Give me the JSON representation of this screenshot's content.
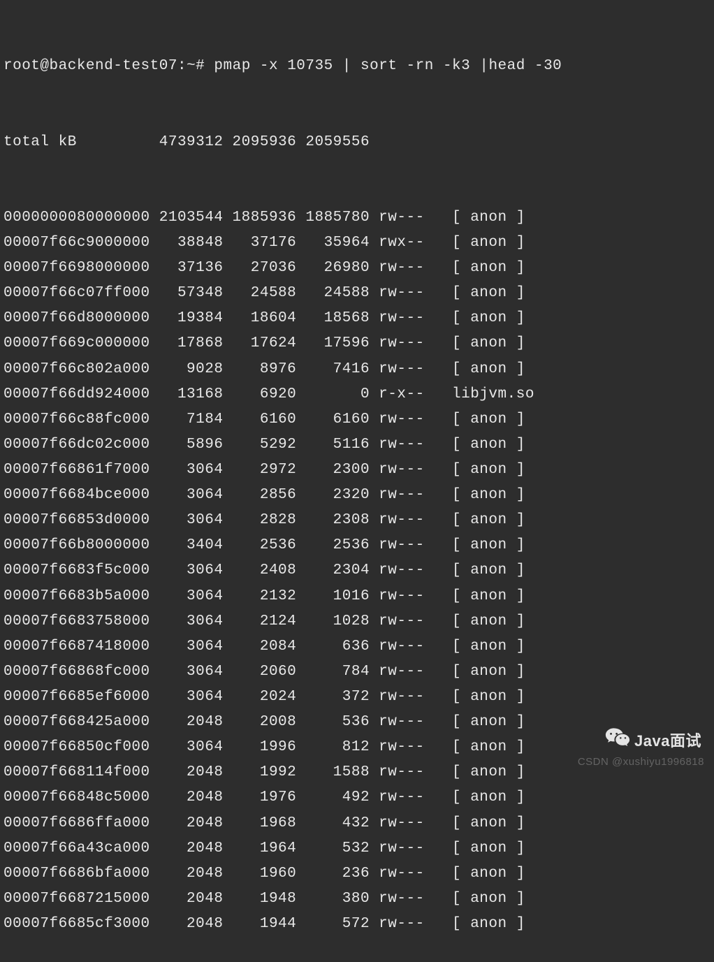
{
  "prompt": {
    "user_host": "root@backend-test07",
    "cwd": "~",
    "symbol": "#",
    "command": "pmap -x 10735 | sort -rn -k3 |head -30"
  },
  "total_row": {
    "label": "total kB",
    "kbytes": "4739312",
    "rss": "2095936",
    "dirty": "2059556"
  },
  "rows": [
    {
      "addr": "0000000080000000",
      "kb": "2103544",
      "rss": "1885936",
      "dirty": "1885780",
      "mode": "rw---",
      "mapping": "[ anon ]"
    },
    {
      "addr": "00007f66c9000000",
      "kb": "38848",
      "rss": "37176",
      "dirty": "35964",
      "mode": "rwx--",
      "mapping": "[ anon ]"
    },
    {
      "addr": "00007f6698000000",
      "kb": "37136",
      "rss": "27036",
      "dirty": "26980",
      "mode": "rw---",
      "mapping": "[ anon ]"
    },
    {
      "addr": "00007f66c07ff000",
      "kb": "57348",
      "rss": "24588",
      "dirty": "24588",
      "mode": "rw---",
      "mapping": "[ anon ]"
    },
    {
      "addr": "00007f66d8000000",
      "kb": "19384",
      "rss": "18604",
      "dirty": "18568",
      "mode": "rw---",
      "mapping": "[ anon ]"
    },
    {
      "addr": "00007f669c000000",
      "kb": "17868",
      "rss": "17624",
      "dirty": "17596",
      "mode": "rw---",
      "mapping": "[ anon ]"
    },
    {
      "addr": "00007f66c802a000",
      "kb": "9028",
      "rss": "8976",
      "dirty": "7416",
      "mode": "rw---",
      "mapping": "[ anon ]"
    },
    {
      "addr": "00007f66dd924000",
      "kb": "13168",
      "rss": "6920",
      "dirty": "0",
      "mode": "r-x--",
      "mapping": "libjvm.so"
    },
    {
      "addr": "00007f66c88fc000",
      "kb": "7184",
      "rss": "6160",
      "dirty": "6160",
      "mode": "rw---",
      "mapping": "[ anon ]"
    },
    {
      "addr": "00007f66dc02c000",
      "kb": "5896",
      "rss": "5292",
      "dirty": "5116",
      "mode": "rw---",
      "mapping": "[ anon ]"
    },
    {
      "addr": "00007f66861f7000",
      "kb": "3064",
      "rss": "2972",
      "dirty": "2300",
      "mode": "rw---",
      "mapping": "[ anon ]"
    },
    {
      "addr": "00007f6684bce000",
      "kb": "3064",
      "rss": "2856",
      "dirty": "2320",
      "mode": "rw---",
      "mapping": "[ anon ]"
    },
    {
      "addr": "00007f66853d0000",
      "kb": "3064",
      "rss": "2828",
      "dirty": "2308",
      "mode": "rw---",
      "mapping": "[ anon ]"
    },
    {
      "addr": "00007f66b8000000",
      "kb": "3404",
      "rss": "2536",
      "dirty": "2536",
      "mode": "rw---",
      "mapping": "[ anon ]"
    },
    {
      "addr": "00007f6683f5c000",
      "kb": "3064",
      "rss": "2408",
      "dirty": "2304",
      "mode": "rw---",
      "mapping": "[ anon ]"
    },
    {
      "addr": "00007f6683b5a000",
      "kb": "3064",
      "rss": "2132",
      "dirty": "1016",
      "mode": "rw---",
      "mapping": "[ anon ]"
    },
    {
      "addr": "00007f6683758000",
      "kb": "3064",
      "rss": "2124",
      "dirty": "1028",
      "mode": "rw---",
      "mapping": "[ anon ]"
    },
    {
      "addr": "00007f6687418000",
      "kb": "3064",
      "rss": "2084",
      "dirty": "636",
      "mode": "rw---",
      "mapping": "[ anon ]"
    },
    {
      "addr": "00007f66868fc000",
      "kb": "3064",
      "rss": "2060",
      "dirty": "784",
      "mode": "rw---",
      "mapping": "[ anon ]"
    },
    {
      "addr": "00007f6685ef6000",
      "kb": "3064",
      "rss": "2024",
      "dirty": "372",
      "mode": "rw---",
      "mapping": "[ anon ]"
    },
    {
      "addr": "00007f668425a000",
      "kb": "2048",
      "rss": "2008",
      "dirty": "536",
      "mode": "rw---",
      "mapping": "[ anon ]"
    },
    {
      "addr": "00007f66850cf000",
      "kb": "3064",
      "rss": "1996",
      "dirty": "812",
      "mode": "rw---",
      "mapping": "[ anon ]"
    },
    {
      "addr": "00007f668114f000",
      "kb": "2048",
      "rss": "1992",
      "dirty": "1588",
      "mode": "rw---",
      "mapping": "[ anon ]"
    },
    {
      "addr": "00007f66848c5000",
      "kb": "2048",
      "rss": "1976",
      "dirty": "492",
      "mode": "rw---",
      "mapping": "[ anon ]"
    },
    {
      "addr": "00007f6686ffa000",
      "kb": "2048",
      "rss": "1968",
      "dirty": "432",
      "mode": "rw---",
      "mapping": "[ anon ]"
    },
    {
      "addr": "00007f66a43ca000",
      "kb": "2048",
      "rss": "1964",
      "dirty": "532",
      "mode": "rw---",
      "mapping": "[ anon ]"
    },
    {
      "addr": "00007f6686bfa000",
      "kb": "2048",
      "rss": "1960",
      "dirty": "236",
      "mode": "rw---",
      "mapping": "[ anon ]"
    },
    {
      "addr": "00007f6687215000",
      "kb": "2048",
      "rss": "1948",
      "dirty": "380",
      "mode": "rw---",
      "mapping": "[ anon ]"
    },
    {
      "addr": "00007f6685cf3000",
      "kb": "2048",
      "rss": "1944",
      "dirty": "572",
      "mode": "rw---",
      "mapping": "[ anon ]"
    }
  ],
  "watermark": {
    "wechat_label": "Java面试",
    "csdn": "CSDN @xushiyu1996818"
  }
}
